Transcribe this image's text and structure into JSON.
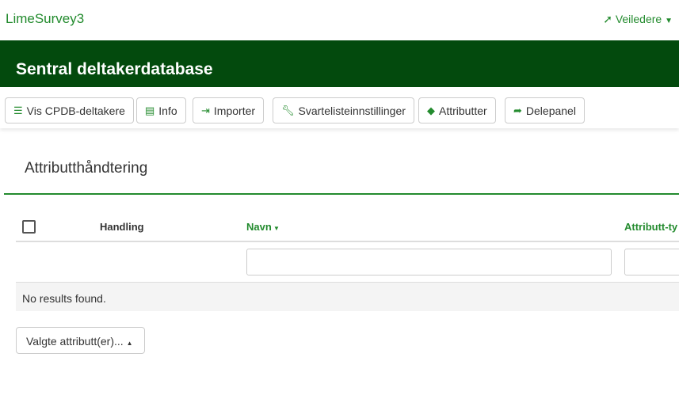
{
  "brand": "LimeSurvey3",
  "user": {
    "label": "Veiledere",
    "icon": "rocket-icon"
  },
  "title": "Sentral deltakerdatabase",
  "toolbar": [
    {
      "label": "Vis CPDB-deltakere",
      "icon": "list-icon"
    },
    {
      "label": "Info",
      "icon": "list-alt-icon"
    },
    {
      "label": "Importer",
      "icon": "import-icon"
    },
    {
      "label": "Svartelisteinnstillinger",
      "icon": "wrench-icon"
    },
    {
      "label": "Attributter",
      "icon": "tag-icon"
    },
    {
      "label": "Delepanel",
      "icon": "share-icon"
    }
  ],
  "section_title": "Attributthåndtering",
  "table": {
    "headers": [
      "Handling",
      "Navn",
      "Attributt-ty"
    ],
    "empty": "No results found."
  },
  "bulk_select": "Valgte attributt(er)...",
  "colors": {
    "brand": "#238b2e",
    "band": "#034a0d"
  }
}
